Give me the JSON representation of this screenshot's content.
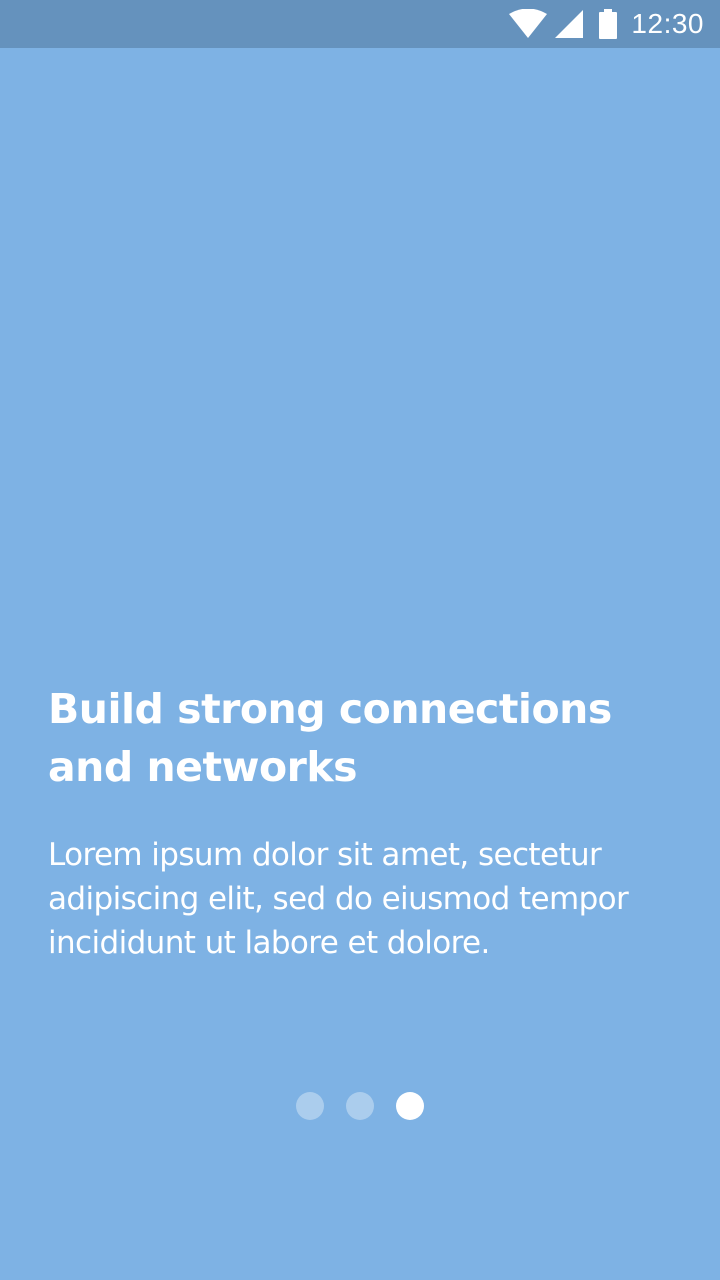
{
  "status_bar": {
    "time": "12:30",
    "icons": [
      "wifi-icon",
      "signal-icon",
      "battery-icon"
    ]
  },
  "onboarding": {
    "title_line1": "Build strong connections",
    "title_line2": "and networks",
    "body_line1": "Lorem ipsum dolor sit amet, sectetur",
    "body_line2": "adipiscing elit, sed do eiusmod tempor",
    "body_line3": "incididunt ut labore et dolore."
  },
  "pager": {
    "page_count": 3,
    "active_index": 2
  },
  "colors": {
    "background": "#7eb2e4",
    "status_bar": "#6592bd",
    "text": "#ffffff"
  }
}
